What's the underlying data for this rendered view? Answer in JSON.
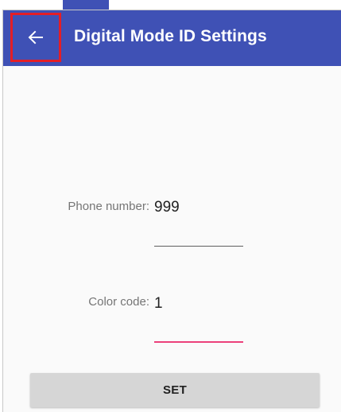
{
  "app_bar": {
    "title": "Digital Mode ID Settings",
    "back_icon": "arrow-left-icon",
    "background_color": "#3f51b5"
  },
  "form": {
    "phone_number": {
      "label": "Phone number:",
      "value": "999"
    },
    "color_code": {
      "label": "Color code:",
      "value": "1"
    },
    "accent_color": "#ec407a"
  },
  "actions": {
    "set_label": "SET"
  },
  "highlight": {
    "color": "#e41e26"
  }
}
